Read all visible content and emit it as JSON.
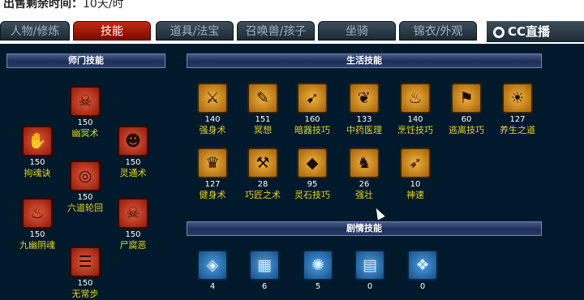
{
  "top": {
    "label": "出售剩余时间：",
    "value": "10天/时"
  },
  "tabs": [
    "人物/修炼",
    "技能",
    "道具/法宝",
    "召唤兽/孩子",
    "坐骑",
    "锦衣/外观"
  ],
  "logo": "CC直播",
  "sections": {
    "master": "师门技能",
    "life": "生活技能",
    "story": "剧情技能"
  },
  "master_skills": [
    {
      "level": "150",
      "name": "幽冥术",
      "icon": "ghost-flame-icon"
    },
    {
      "level": "150",
      "name": "拘魂诀",
      "icon": "hand-seal-icon"
    },
    {
      "level": "150",
      "name": "灵通术",
      "icon": "ape-face-icon"
    },
    {
      "level": "150",
      "name": "六道轮回",
      "icon": "wheel-icon"
    },
    {
      "level": "150",
      "name": "九幽阴魂",
      "icon": "ghosts-icon"
    },
    {
      "level": "150",
      "name": "尸腐恶",
      "icon": "skull-icon"
    },
    {
      "level": "150",
      "name": "无常步",
      "icon": "footprint-icon"
    }
  ],
  "life_skills": [
    {
      "level": "140",
      "name": "强身术",
      "icon": "body-icon"
    },
    {
      "level": "151",
      "name": "冥想",
      "icon": "scroll-icon"
    },
    {
      "level": "160",
      "name": "暗器技巧",
      "icon": "dart-icon"
    },
    {
      "level": "133",
      "name": "中药医理",
      "icon": "herb-icon"
    },
    {
      "level": "140",
      "name": "烹饪技巧",
      "icon": "cooking-icon"
    },
    {
      "level": "60",
      "name": "逃离技巧",
      "icon": "escape-icon"
    },
    {
      "level": "127",
      "name": "养生之道",
      "icon": "sun-icon"
    },
    {
      "level": "127",
      "name": "健身术",
      "icon": "muscle-icon"
    },
    {
      "level": "28",
      "name": "巧匠之术",
      "icon": "anvil-icon"
    },
    {
      "level": "95",
      "name": "灵石技巧",
      "icon": "gem-icon"
    },
    {
      "level": "26",
      "name": "强壮",
      "icon": "strong-icon"
    },
    {
      "level": "10",
      "name": "神速",
      "icon": "speed-icon"
    }
  ],
  "story_skills": [
    {
      "level": "4",
      "name": "",
      "icon": "diamond-icon"
    },
    {
      "level": "6",
      "name": "",
      "icon": "map-icon"
    },
    {
      "level": "5",
      "name": "",
      "icon": "star-icon"
    },
    {
      "level": "0",
      "name": "",
      "icon": "box-icon"
    },
    {
      "level": "0",
      "name": "",
      "icon": "scroll-map-icon"
    }
  ],
  "colors": {
    "active_tab": "#a51a08",
    "panel_bg": "#001a2b",
    "skill_name": "#e8d21f"
  }
}
